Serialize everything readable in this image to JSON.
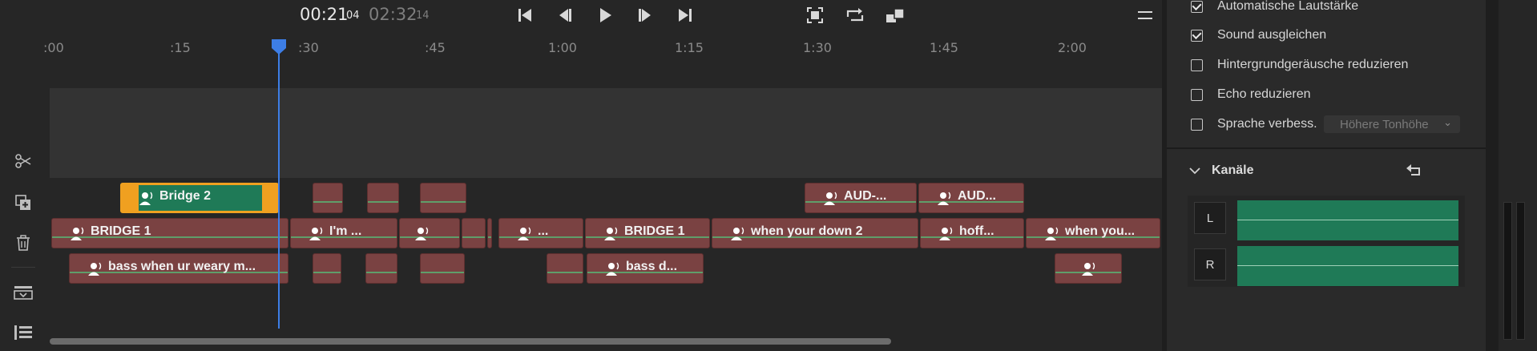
{
  "transport": {
    "current_time": "00:21",
    "current_frame": "04",
    "total_time": "02:32",
    "total_frame": "14",
    "buttons": [
      "go-to-start",
      "step-back",
      "play",
      "step-forward",
      "go-to-end"
    ],
    "view_buttons": [
      "fit-timeline",
      "loop",
      "marker-stack",
      "menu"
    ]
  },
  "ruler": {
    "ticks": [
      ":00",
      ":15",
      ":30",
      ":45",
      "1:00",
      "1:15",
      "1:30",
      "1:45",
      "2:00"
    ]
  },
  "tracks": {
    "row1": [
      {
        "label": "Bridge 2",
        "selected": true
      },
      {
        "label": ""
      },
      {
        "label": ""
      },
      {
        "label": ""
      },
      {
        "label": "AUD-..."
      },
      {
        "label": "AUD..."
      }
    ],
    "row2": [
      {
        "label": "BRIDGE 1"
      },
      {
        "label": "I'm ..."
      },
      {
        "label": ""
      },
      {
        "label": ""
      },
      {
        "label": "..."
      },
      {
        "label": "BRIDGE 1"
      },
      {
        "label": "when your down 2"
      },
      {
        "label": "hoff..."
      },
      {
        "label": "when you..."
      }
    ],
    "row3": [
      {
        "label": "bass when ur weary m..."
      },
      {
        "label": ""
      },
      {
        "label": ""
      },
      {
        "label": ""
      },
      {
        "label": ""
      },
      {
        "label": "bass d..."
      },
      {
        "label": ""
      }
    ]
  },
  "panel": {
    "checkboxes": [
      {
        "label": "Automatische Lautstärke",
        "checked": true
      },
      {
        "label": "Sound ausgleichen",
        "checked": true
      },
      {
        "label": "Hintergrundgeräusche reduzieren",
        "checked": false
      },
      {
        "label": "Echo reduzieren",
        "checked": false
      },
      {
        "label": "Sprache verbess.",
        "checked": false
      }
    ],
    "pitch_select": "Höhere Tonhöhe",
    "channels_title": "Kanäle",
    "channels": [
      "L",
      "R"
    ]
  },
  "colors": {
    "clip": "#7a4242",
    "selected_clip_border": "#f0a020",
    "meter_green": "#1f7a57",
    "playhead": "#3d7ee6"
  }
}
